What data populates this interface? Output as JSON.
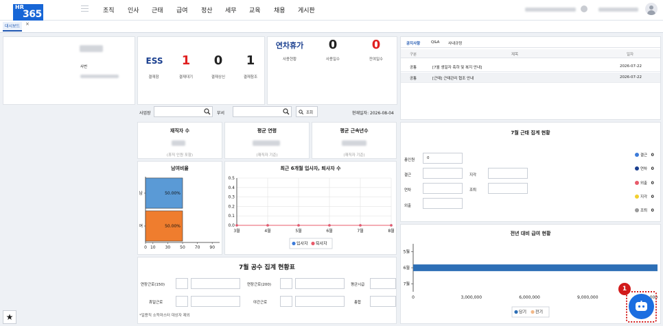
{
  "brand": {
    "line1": "HR",
    "line2": "365"
  },
  "nav": {
    "items": [
      "조직",
      "인사",
      "근태",
      "급여",
      "정산",
      "세무",
      "교육",
      "채용",
      "게시판"
    ]
  },
  "tabs": {
    "dashboard": "대시보드",
    "close": "×"
  },
  "profile": {
    "id_label": "사번"
  },
  "ess": {
    "title": "ESS",
    "stats": [
      {
        "value": "1",
        "label": "결재함",
        "color": "#1766d6"
      },
      {
        "value": "1",
        "label": "결재대기",
        "color": "#e02020"
      },
      {
        "value": "0",
        "label": "결재상신",
        "color": "#111111"
      },
      {
        "value": "1",
        "label": "결재참조",
        "color": "#111111"
      }
    ]
  },
  "leave": {
    "title": "연차휴가",
    "stats": [
      {
        "value": "0",
        "label": "사용현황",
        "color": "#111111"
      },
      {
        "value": "0",
        "label": "사용일수",
        "color": "#111111"
      },
      {
        "value": "0",
        "label": "잔여일수",
        "color": "#e02020"
      }
    ]
  },
  "notice": {
    "tabs": [
      "공지사항",
      "Q&A",
      "사내규정"
    ],
    "headers": [
      "구분",
      "제목",
      "일자"
    ],
    "rows": [
      {
        "type": "공통",
        "title": "[7월 생일자 축하 및 복지 안내]",
        "date": "2026-07-22"
      },
      {
        "type": "공통",
        "title": "[근태] 근태관리 협조 안내",
        "date": "2026-07-22"
      }
    ]
  },
  "filter": {
    "site_label": "사업장",
    "dept_label": "부서",
    "search_label": "조회",
    "current_date": "현재일자: 2026-08-04"
  },
  "kpis": [
    {
      "title": "재직자 수",
      "note": "(휴직 인원 포함)"
    },
    {
      "title": "평균 연령",
      "note": "(재직자 기준)"
    },
    {
      "title": "평균 근속년수",
      "note": "(재직자 기준)"
    }
  ],
  "gender": {
    "title": "남여비율"
  },
  "hires": {
    "title": "최근 6개월 입사자, 퇴사자 수"
  },
  "attendance": {
    "title": "7월 근태 집계 현황",
    "fields": {
      "total_label": "총인원",
      "total_value": "0",
      "absent_label": "결근",
      "late_label": "지각",
      "leave_label": "연차",
      "early_label": "조퇴",
      "out_label": "외출"
    },
    "legend": [
      {
        "label": "결근",
        "value": "0",
        "color": "#3d7bd9"
      },
      {
        "label": "연차",
        "value": "0",
        "color": "#1b3f8f"
      },
      {
        "label": "외출",
        "value": "0",
        "color": "#e85a6a"
      },
      {
        "label": "지각",
        "value": "0",
        "color": "#f2cf2f"
      },
      {
        "label": "조퇴",
        "value": "0",
        "color": "#9a9a9a"
      }
    ]
  },
  "salary": {
    "title": "전년 대비 급여 현황"
  },
  "workhours": {
    "title": "7월 공수 집계 현황표",
    "labels": {
      "ext150": "연장근로(150)",
      "ext200": "연장근로(200)",
      "avg_rate": "평균시급",
      "holiday": "휴일근로",
      "night": "야간근로",
      "total": "총합"
    },
    "footnote": "*일용직 소득마스터 대상자 제외"
  },
  "badge": {
    "value": "1"
  },
  "colors": {
    "accent": "#1766d6",
    "male": "#5a9ad6",
    "female": "#ef7d2e",
    "current_bar": "#2d6fb6"
  },
  "chart_data": [
    {
      "type": "bar",
      "title": "남여비율",
      "orientation": "horizontal",
      "categories": [
        "남",
        "여"
      ],
      "values": [
        50,
        50
      ],
      "data_labels": [
        "50.00%",
        "50.00%"
      ],
      "x_ticks": [
        "0",
        "10",
        "30",
        "50",
        "70",
        "90"
      ],
      "xlim": [
        0,
        100
      ]
    },
    {
      "type": "line",
      "title": "최근 6개월 입사자, 퇴사자 수",
      "categories": [
        "3월",
        "4월",
        "5월",
        "6월",
        "7월",
        "8월"
      ],
      "series": [
        {
          "name": "입사자",
          "values": [
            0,
            0,
            0,
            0,
            0,
            0
          ],
          "color": "#3d7bd9"
        },
        {
          "name": "퇴사자",
          "values": [
            0,
            0,
            0,
            0,
            0,
            0
          ],
          "color": "#e85a6a"
        }
      ],
      "y_ticks": [
        "0.0",
        "0.1",
        "0.2",
        "0.3",
        "0.4",
        "0.5"
      ],
      "ylim": [
        0,
        0.5
      ],
      "grid": true,
      "legend": "bottom"
    },
    {
      "type": "bar",
      "title": "전년 대비 급여 현황",
      "orientation": "horizontal",
      "categories": [
        "5월",
        "6월",
        "7월"
      ],
      "series": [
        {
          "name": "당기",
          "values": [
            0,
            12600000,
            0
          ],
          "color": "#2d6fb6"
        },
        {
          "name": "전기",
          "values": [
            0,
            0,
            0
          ],
          "color": "#f2b98a"
        }
      ],
      "x_ticks": [
        "0",
        "3,000,000",
        "6,000,000",
        "9,000,000",
        "12,000,000"
      ],
      "xlim": [
        0,
        12600000
      ],
      "legend": "bottom"
    }
  ]
}
